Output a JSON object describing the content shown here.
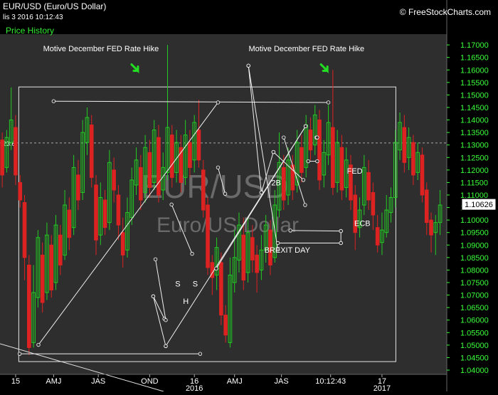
{
  "header": {
    "symbol": "EUR/USD (Euro/US Dollar)",
    "date_time": "lis 3 2016 10:12:43",
    "price_history_label": "Price History",
    "brand": "© FreeStockCharts.com"
  },
  "chart_data": {
    "type": "candlestick",
    "title": "EUR/USD (Euro/US Dollar)",
    "watermark": [
      "EUR/USD",
      "Euro/US Dollar"
    ],
    "y_axis": {
      "side": "right",
      "ylim": [
        1.0383,
        1.1743
      ],
      "ticks": [
        1.04,
        1.045,
        1.05,
        1.055,
        1.06,
        1.065,
        1.07,
        1.075,
        1.08,
        1.085,
        1.09,
        1.095,
        1.1,
        1.105,
        1.11,
        1.115,
        1.12,
        1.125,
        1.13,
        1.135,
        1.14,
        1.145,
        1.15,
        1.155,
        1.16,
        1.165,
        1.17
      ],
      "tick_labels": [
        "1.04000",
        "1.04500",
        "1.05000",
        "1.05500",
        "1.06000",
        "1.06500",
        "1.07000",
        "1.07500",
        "1.08000",
        "1.08500",
        "1.09000",
        "1.09500",
        "1.10000",
        "1.10500",
        "1.11000",
        "1.11500",
        "1.12000",
        "1.12500",
        "1.13000",
        "1.13500",
        "1.14000",
        "1.14500",
        "1.15000",
        "1.15500",
        "1.16000",
        "1.16500",
        "1.17000"
      ],
      "color": "#39ff39"
    },
    "x_axis": {
      "range": [
        0,
        100
      ],
      "ticks": [
        {
          "x": 3.5,
          "label": "15"
        },
        {
          "x": 12,
          "label": "AMJ"
        },
        {
          "x": 22,
          "label": "JAS"
        },
        {
          "x": 33.5,
          "label": "OND"
        },
        {
          "x": 43.5,
          "label": "16"
        },
        {
          "x": 52.5,
          "label": "AMJ"
        },
        {
          "x": 63,
          "label": "JAS"
        },
        {
          "x": 74,
          "label": "10:12:43"
        },
        {
          "x": 85.5,
          "label": "17"
        }
      ],
      "second_row": [
        {
          "x": 43.5,
          "label": "2016"
        },
        {
          "x": 85.5,
          "label": "2017"
        }
      ]
    },
    "last_price": {
      "value": 1.10626,
      "label": "1.10626"
    },
    "horizontal_level": {
      "value": 1.1308,
      "label": "23.6",
      "style": "dashed"
    },
    "reference_box": {
      "x": [
        4.2,
        88.6
      ],
      "y": [
        1.0434,
        1.1532
      ]
    },
    "candles": [
      {
        "x": 0.5,
        "o": 1.132,
        "c": 1.118,
        "h": 1.135,
        "l": 1.113
      },
      {
        "x": 1.5,
        "o": 1.121,
        "c": 1.133,
        "h": 1.136,
        "l": 1.119
      },
      {
        "x": 2.5,
        "o": 1.131,
        "c": 1.14,
        "h": 1.153,
        "l": 1.128
      },
      {
        "x": 3.5,
        "o": 1.137,
        "c": 1.118,
        "h": 1.142,
        "l": 1.114
      },
      {
        "x": 4.5,
        "o": 1.115,
        "c": 1.108,
        "h": 1.118,
        "l": 1.105
      },
      {
        "x": 5.5,
        "o": 1.107,
        "c": 1.085,
        "h": 1.11,
        "l": 1.076
      },
      {
        "x": 6.5,
        "o": 1.082,
        "c": 1.049,
        "h": 1.086,
        "l": 1.046
      },
      {
        "x": 7.5,
        "o": 1.051,
        "c": 1.071,
        "h": 1.082,
        "l": 1.049
      },
      {
        "x": 8.5,
        "o": 1.069,
        "c": 1.093,
        "h": 1.096,
        "l": 1.065
      },
      {
        "x": 9.5,
        "o": 1.086,
        "c": 1.067,
        "h": 1.091,
        "l": 1.063
      },
      {
        "x": 10.5,
        "o": 1.071,
        "c": 1.094,
        "h": 1.099,
        "l": 1.068
      },
      {
        "x": 11.5,
        "o": 1.09,
        "c": 1.072,
        "h": 1.094,
        "l": 1.069
      },
      {
        "x": 12.5,
        "o": 1.075,
        "c": 1.098,
        "h": 1.102,
        "l": 1.072
      },
      {
        "x": 13.5,
        "o": 1.094,
        "c": 1.082,
        "h": 1.098,
        "l": 1.078
      },
      {
        "x": 14.5,
        "o": 1.086,
        "c": 1.106,
        "h": 1.112,
        "l": 1.084
      },
      {
        "x": 15.5,
        "o": 1.104,
        "c": 1.093,
        "h": 1.109,
        "l": 1.088
      },
      {
        "x": 16.5,
        "o": 1.097,
        "c": 1.121,
        "h": 1.126,
        "l": 1.094
      },
      {
        "x": 17.5,
        "o": 1.118,
        "c": 1.108,
        "h": 1.124,
        "l": 1.104
      },
      {
        "x": 18.5,
        "o": 1.111,
        "c": 1.135,
        "h": 1.14,
        "l": 1.108
      },
      {
        "x": 19.5,
        "o": 1.131,
        "c": 1.141,
        "h": 1.145,
        "l": 1.126
      },
      {
        "x": 20.5,
        "o": 1.138,
        "c": 1.117,
        "h": 1.142,
        "l": 1.113
      },
      {
        "x": 21.5,
        "o": 1.114,
        "c": 1.092,
        "h": 1.118,
        "l": 1.086
      },
      {
        "x": 22.5,
        "o": 1.094,
        "c": 1.109,
        "h": 1.115,
        "l": 1.09
      },
      {
        "x": 23.5,
        "o": 1.108,
        "c": 1.097,
        "h": 1.112,
        "l": 1.094
      },
      {
        "x": 24.5,
        "o": 1.099,
        "c": 1.123,
        "h": 1.128,
        "l": 1.096
      },
      {
        "x": 25.5,
        "o": 1.12,
        "c": 1.112,
        "h": 1.125,
        "l": 1.107
      },
      {
        "x": 26.5,
        "o": 1.11,
        "c": 1.098,
        "h": 1.114,
        "l": 1.092
      },
      {
        "x": 27.5,
        "o": 1.095,
        "c": 1.086,
        "h": 1.101,
        "l": 1.081
      },
      {
        "x": 28.5,
        "o": 1.088,
        "c": 1.103,
        "h": 1.109,
        "l": 1.085
      },
      {
        "x": 29.5,
        "o": 1.101,
        "c": 1.116,
        "h": 1.121,
        "l": 1.098
      },
      {
        "x": 30.5,
        "o": 1.114,
        "c": 1.124,
        "h": 1.129,
        "l": 1.11
      },
      {
        "x": 31.5,
        "o": 1.121,
        "c": 1.108,
        "h": 1.126,
        "l": 1.104
      },
      {
        "x": 32.5,
        "o": 1.111,
        "c": 1.129,
        "h": 1.134,
        "l": 1.107
      },
      {
        "x": 33.5,
        "o": 1.127,
        "c": 1.113,
        "h": 1.132,
        "l": 1.109
      },
      {
        "x": 34.5,
        "o": 1.115,
        "c": 1.136,
        "h": 1.14,
        "l": 1.112
      },
      {
        "x": 35.5,
        "o": 1.133,
        "c": 1.11,
        "h": 1.138,
        "l": 1.107
      },
      {
        "x": 36.5,
        "o": 1.112,
        "c": 1.121,
        "h": 1.127,
        "l": 1.108
      },
      {
        "x": 37.5,
        "o": 1.119,
        "c": 1.137,
        "h": 1.17,
        "l": 1.116
      },
      {
        "x": 38.5,
        "o": 1.134,
        "c": 1.117,
        "h": 1.138,
        "l": 1.113
      },
      {
        "x": 39.5,
        "o": 1.119,
        "c": 1.131,
        "h": 1.136,
        "l": 1.115
      },
      {
        "x": 40.5,
        "o": 1.129,
        "c": 1.115,
        "h": 1.134,
        "l": 1.111
      },
      {
        "x": 41.5,
        "o": 1.117,
        "c": 1.134,
        "h": 1.14,
        "l": 1.114
      },
      {
        "x": 42.5,
        "o": 1.131,
        "c": 1.121,
        "h": 1.136,
        "l": 1.117
      },
      {
        "x": 43.5,
        "o": 1.124,
        "c": 1.139,
        "h": 1.142,
        "l": 1.119
      },
      {
        "x": 44.5,
        "o": 1.136,
        "c": 1.124,
        "h": 1.148,
        "l": 1.121
      },
      {
        "x": 45.5,
        "o": 1.12,
        "c": 1.104,
        "h": 1.124,
        "l": 1.101
      },
      {
        "x": 46.5,
        "o": 1.106,
        "c": 1.081,
        "h": 1.109,
        "l": 1.078
      },
      {
        "x": 47.5,
        "o": 1.083,
        "c": 1.077,
        "h": 1.086,
        "l": 1.07
      },
      {
        "x": 48.5,
        "o": 1.078,
        "c": 1.089,
        "h": 1.093,
        "l": 1.072
      },
      {
        "x": 49.5,
        "o": 1.083,
        "c": 1.062,
        "h": 1.087,
        "l": 1.058
      },
      {
        "x": 50.5,
        "o": 1.062,
        "c": 1.054,
        "h": 1.066,
        "l": 1.051
      },
      {
        "x": 51.5,
        "o": 1.051,
        "c": 1.078,
        "h": 1.085,
        "l": 1.049
      },
      {
        "x": 52.5,
        "o": 1.075,
        "c": 1.085,
        "h": 1.096,
        "l": 1.071
      },
      {
        "x": 53.5,
        "o": 1.084,
        "c": 1.098,
        "h": 1.103,
        "l": 1.079
      },
      {
        "x": 54.5,
        "o": 1.094,
        "c": 1.076,
        "h": 1.101,
        "l": 1.072
      },
      {
        "x": 55.5,
        "o": 1.079,
        "c": 1.095,
        "h": 1.101,
        "l": 1.075
      },
      {
        "x": 56.5,
        "o": 1.093,
        "c": 1.084,
        "h": 1.098,
        "l": 1.079
      },
      {
        "x": 57.5,
        "o": 1.086,
        "c": 1.079,
        "h": 1.09,
        "l": 1.071
      },
      {
        "x": 58.5,
        "o": 1.08,
        "c": 1.088,
        "h": 1.094,
        "l": 1.076
      },
      {
        "x": 59.5,
        "o": 1.088,
        "c": 1.098,
        "h": 1.102,
        "l": 1.083
      },
      {
        "x": 60.5,
        "o": 1.096,
        "c": 1.082,
        "h": 1.1,
        "l": 1.078
      },
      {
        "x": 61.5,
        "o": 1.085,
        "c": 1.106,
        "h": 1.112,
        "l": 1.083
      },
      {
        "x": 62.5,
        "o": 1.104,
        "c": 1.123,
        "h": 1.135,
        "l": 1.101
      },
      {
        "x": 63.5,
        "o": 1.121,
        "c": 1.108,
        "h": 1.126,
        "l": 1.104
      },
      {
        "x": 64.5,
        "o": 1.11,
        "c": 1.124,
        "h": 1.129,
        "l": 1.106
      },
      {
        "x": 65.5,
        "o": 1.122,
        "c": 1.112,
        "h": 1.126,
        "l": 1.108
      },
      {
        "x": 66.5,
        "o": 1.114,
        "c": 1.131,
        "h": 1.136,
        "l": 1.111
      },
      {
        "x": 67.5,
        "o": 1.129,
        "c": 1.119,
        "h": 1.134,
        "l": 1.115
      },
      {
        "x": 68.5,
        "o": 1.121,
        "c": 1.138,
        "h": 1.142,
        "l": 1.117
      },
      {
        "x": 69.5,
        "o": 1.136,
        "c": 1.128,
        "h": 1.141,
        "l": 1.124
      },
      {
        "x": 70.5,
        "o": 1.13,
        "c": 1.142,
        "h": 1.146,
        "l": 1.126
      },
      {
        "x": 71.5,
        "o": 1.14,
        "c": 1.116,
        "h": 1.144,
        "l": 1.112
      },
      {
        "x": 72.5,
        "o": 1.118,
        "c": 1.127,
        "h": 1.132,
        "l": 1.113
      },
      {
        "x": 73.5,
        "o": 1.126,
        "c": 1.139,
        "h": 1.146,
        "l": 1.122
      },
      {
        "x": 74.5,
        "o": 1.137,
        "c": 1.113,
        "h": 1.16,
        "l": 1.11
      },
      {
        "x": 75.5,
        "o": 1.115,
        "c": 1.131,
        "h": 1.136,
        "l": 1.111
      },
      {
        "x": 76.5,
        "o": 1.129,
        "c": 1.112,
        "h": 1.134,
        "l": 1.108
      },
      {
        "x": 77.5,
        "o": 1.113,
        "c": 1.124,
        "h": 1.129,
        "l": 1.109
      },
      {
        "x": 78.5,
        "o": 1.122,
        "c": 1.108,
        "h": 1.126,
        "l": 1.104
      },
      {
        "x": 79.5,
        "o": 1.11,
        "c": 1.095,
        "h": 1.114,
        "l": 1.088
      },
      {
        "x": 80.5,
        "o": 1.097,
        "c": 1.104,
        "h": 1.109,
        "l": 1.093
      },
      {
        "x": 81.5,
        "o": 1.106,
        "c": 1.121,
        "h": 1.126,
        "l": 1.102
      },
      {
        "x": 82.5,
        "o": 1.119,
        "c": 1.108,
        "h": 1.124,
        "l": 1.104
      },
      {
        "x": 83.5,
        "o": 1.111,
        "c": 1.102,
        "h": 1.115,
        "l": 1.096
      },
      {
        "x": 84.5,
        "o": 1.097,
        "c": 1.09,
        "h": 1.102,
        "l": 1.087
      },
      {
        "x": 85.5,
        "o": 1.091,
        "c": 1.096,
        "h": 1.103,
        "l": 1.086
      },
      {
        "x": 86.5,
        "o": 1.095,
        "c": 1.104,
        "h": 1.11,
        "l": 1.093
      },
      {
        "x": 87.5,
        "o": 1.103,
        "c": 1.109,
        "h": 1.113,
        "l": 1.099
      },
      {
        "x": 88.5,
        "o": 1.109,
        "c": 1.131,
        "h": 1.136,
        "l": 1.105
      },
      {
        "x": 89.5,
        "o": 1.128,
        "c": 1.139,
        "h": 1.143,
        "l": 1.124
      },
      {
        "x": 90.5,
        "o": 1.137,
        "c": 1.123,
        "h": 1.142,
        "l": 1.119
      },
      {
        "x": 91.5,
        "o": 1.125,
        "c": 1.133,
        "h": 1.137,
        "l": 1.12
      },
      {
        "x": 92.5,
        "o": 1.131,
        "c": 1.118,
        "h": 1.134,
        "l": 1.114
      },
      {
        "x": 93.5,
        "o": 1.119,
        "c": 1.127,
        "h": 1.131,
        "l": 1.116
      },
      {
        "x": 94.5,
        "o": 1.126,
        "c": 1.11,
        "h": 1.129,
        "l": 1.107
      },
      {
        "x": 95.5,
        "o": 1.112,
        "c": 1.099,
        "h": 1.115,
        "l": 1.094
      },
      {
        "x": 96.5,
        "o": 1.1,
        "c": 1.094,
        "h": 1.103,
        "l": 1.087
      },
      {
        "x": 97.5,
        "o": 1.095,
        "c": 1.099,
        "h": 1.102,
        "l": 1.086
      },
      {
        "x": 98.5,
        "o": 1.099,
        "c": 1.106,
        "h": 1.112,
        "l": 1.094
      }
    ],
    "annotations": [
      {
        "x": 22.6,
        "y": 1.1675,
        "label": "Motive December FED Rate Hike"
      },
      {
        "x": 68.6,
        "y": 1.1675,
        "label": "Motive December FED Rate Hike"
      },
      {
        "x": 61.8,
        "y": 1.1138,
        "label": "2B"
      },
      {
        "x": 39.8,
        "y": 1.0734,
        "label": "S"
      },
      {
        "x": 41.6,
        "y": 1.0664,
        "label": "H"
      },
      {
        "x": 43.7,
        "y": 1.0734,
        "label": "S"
      },
      {
        "x": 64.3,
        "y": 1.087,
        "label": "BREXIT DAY"
      },
      {
        "x": 79.4,
        "y": 1.1185,
        "label": "FED"
      },
      {
        "x": 81.1,
        "y": 1.0976,
        "label": "ECB"
      }
    ],
    "arrows": [
      {
        "x": 30.4,
        "y": 1.1605
      },
      {
        "x": 72.8,
        "y": 1.1605
      }
    ],
    "trendlines": [
      {
        "x1": 12.0,
        "y1": 1.1475,
        "x2": 73.5,
        "y2": 1.147
      },
      {
        "x1": 8.6,
        "y1": 1.0501,
        "x2": 48.8,
        "y2": 1.147
      },
      {
        "x1": 4.4,
        "y1": 1.0465,
        "x2": 44.8,
        "y2": 1.0465
      },
      {
        "x1": 37.1,
        "y1": 1.0496,
        "x2": 68.4,
        "y2": 1.1375
      },
      {
        "x1": 48.4,
        "y1": 1.0806,
        "x2": 68.4,
        "y2": 1.1375
      },
      {
        "x1": 55.6,
        "y1": 1.1617,
        "x2": 58.5,
        "y2": 1.111
      },
      {
        "x1": 55.6,
        "y1": 1.1617,
        "x2": 62.2,
        "y2": 1.0882
      },
      {
        "x1": 58.5,
        "y1": 1.111,
        "x2": 61.2,
        "y2": 1.1272
      },
      {
        "x1": 61.2,
        "y1": 1.1272,
        "x2": 67.9,
        "y2": 1.116
      },
      {
        "x1": 65.0,
        "y1": 1.0958,
        "x2": 76.3,
        "y2": 1.0956
      },
      {
        "x1": 76.3,
        "y1": 1.0956,
        "x2": 76.3,
        "y2": 1.0908
      },
      {
        "x1": 62.2,
        "y1": 1.0908,
        "x2": 76.3,
        "y2": 1.0908
      },
      {
        "x1": 69.0,
        "y1": 1.1235,
        "x2": 71.0,
        "y2": 1.1235
      },
      {
        "x1": 70.8,
        "y1": 1.133,
        "x2": 71.0,
        "y2": 1.133
      },
      {
        "x1": 34.3,
        "y1": 1.0695,
        "x2": 36.8,
        "y2": 1.0605
      },
      {
        "x1": 34.3,
        "y1": 1.0695,
        "x2": 37.1,
        "y2": 1.0496
      },
      {
        "x1": 34.8,
        "y1": 1.0843,
        "x2": 37.1,
        "y2": 1.06
      },
      {
        "x1": 38.4,
        "y1": 1.1062,
        "x2": 43.0,
        "y2": 1.0865
      },
      {
        "x1": 48.8,
        "y1": 1.121,
        "x2": 50.4,
        "y2": 1.1105
      },
      {
        "x1": 68.3,
        "y1": 1.106,
        "x2": 63.5,
        "y2": 1.133
      }
    ],
    "grid": false,
    "legend": "none"
  },
  "colors": {
    "background": "#000000",
    "plot_area": "#333333",
    "up_candle": "#22cc22",
    "down_candle": "#dd2222",
    "axis_text": "#39ff39",
    "annotation": "#ffffff"
  }
}
